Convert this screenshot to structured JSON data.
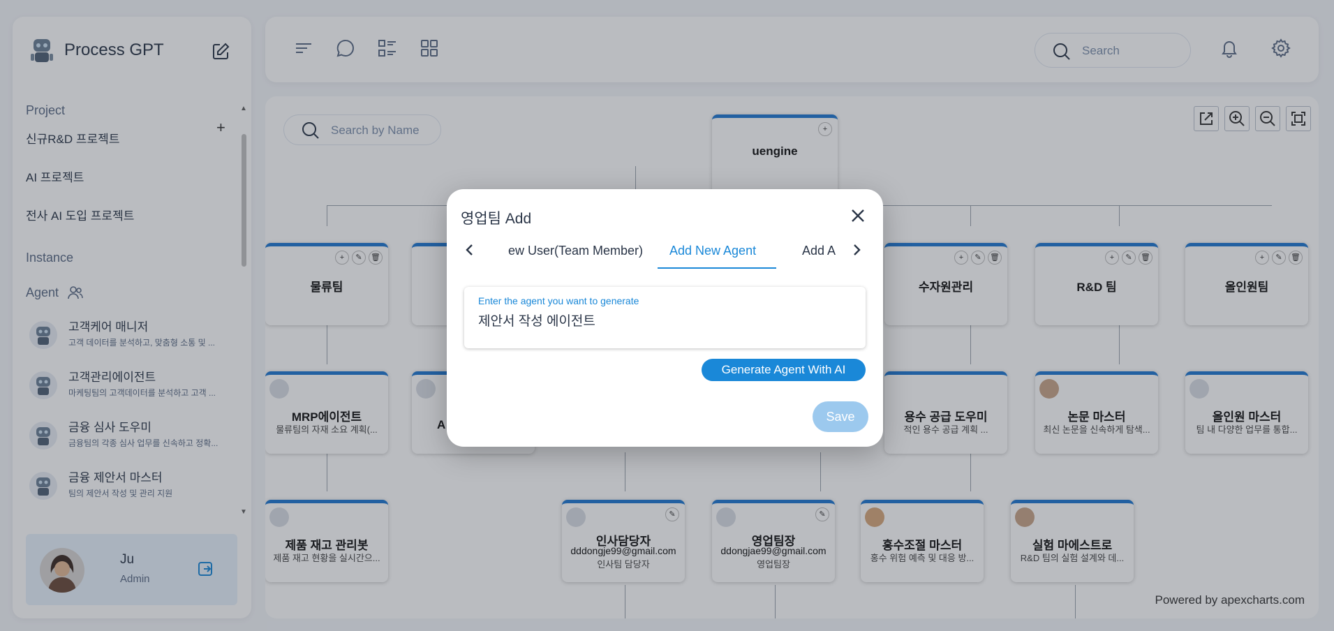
{
  "sidebar": {
    "brand": "Process GPT",
    "project_label": "Project",
    "projects": [
      "신규R&D 프로젝트",
      "AI 프로젝트",
      "전사 AI 도입 프로젝트"
    ],
    "instance_label": "Instance",
    "agent_label": "Agent",
    "agents": [
      {
        "name": "고객케어 매니저",
        "desc": "고객 데이터를 분석하고, 맞춤형 소통 및 ..."
      },
      {
        "name": "고객관리에이전트",
        "desc": "마케팅팀의 고객데이터를 분석하고 고객 ..."
      },
      {
        "name": "금융 심사 도우미",
        "desc": "금융팀의 각종 심사 업무를 신속하고 정확..."
      },
      {
        "name": "금융 제안서 마스터",
        "desc": "팀의 제안서 작성 및 관리 지원"
      }
    ],
    "user": {
      "name": "Ju",
      "role": "Admin"
    }
  },
  "topbar": {
    "search_placeholder": "Search"
  },
  "canvas": {
    "search_placeholder": "Search by Name",
    "powered_by": "Powered by apexcharts.com",
    "root": "uengine",
    "teams": [
      "물류팀",
      "수자원관리",
      "R&D 팀",
      "올인원팀"
    ],
    "agents_row": [
      {
        "title": "MRP에이전트",
        "sub": "물류팀의 자재 소요 계획(..."
      },
      {
        "title": "A",
        "sub": ""
      },
      {
        "title": "용수 공급 도우미",
        "sub": "적인 용수 공급 계획 ..."
      },
      {
        "title": "논문 마스터",
        "sub": "최신 논문을 신속하게 탐색..."
      },
      {
        "title": "올인원 마스터",
        "sub": "팀 내 다양한 업무를 통합..."
      }
    ],
    "members_row": [
      {
        "title": "제품 재고 관리봇",
        "sub": "제품 재고 현황을 실시간으...",
        "email": ""
      },
      {
        "title": "인사담당자",
        "email": "dddongje99@gmail.com",
        "sub": "인사팀 담당자"
      },
      {
        "title": "영업팀장",
        "email": "ddongjae99@gmail.com",
        "sub": "영업팀장"
      },
      {
        "title": "홍수조절 마스터",
        "sub": "홍수 위험 예측 및 대응 방...",
        "email": ""
      },
      {
        "title": "실험 마에스트로",
        "sub": "R&D 팀의 실험 설계와 데...",
        "email": ""
      }
    ]
  },
  "modal": {
    "title": "영업팀 Add",
    "tabs": [
      "ew User(Team Member)",
      "Add New Agent",
      "Add A"
    ],
    "field_label": "Enter the agent you want to generate",
    "field_value": "제안서 작성 에이전트",
    "generate_label": "Generate Agent With AI",
    "save_label": "Save"
  },
  "colors": {
    "accent": "#1a88d8",
    "node_border": "#1f78d1",
    "save_disabled": "#9cc9ee"
  }
}
